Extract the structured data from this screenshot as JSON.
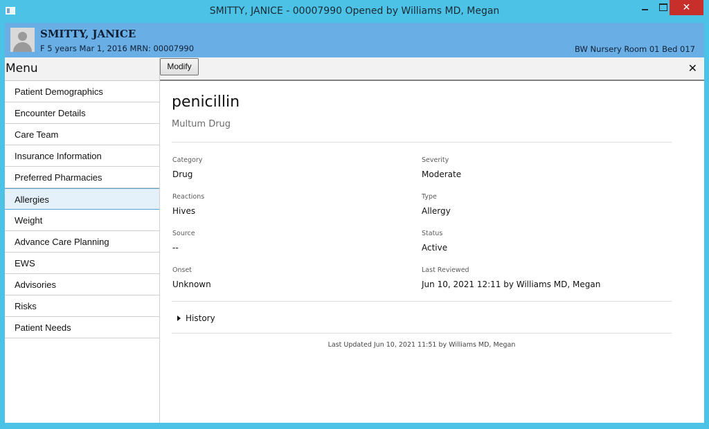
{
  "window": {
    "title": "SMITTY, JANICE - 00007990 Opened by Williams MD, Megan",
    "close_glyph": "✕"
  },
  "patient": {
    "name": "SMITTY, JANICE",
    "info": "F 5 years Mar 1, 2016 MRN: 00007990",
    "location": "BW Nursery Room 01 Bed 017"
  },
  "menu": {
    "header": "Menu",
    "items": [
      {
        "label": "Patient Demographics"
      },
      {
        "label": "Encounter Details"
      },
      {
        "label": "Care Team"
      },
      {
        "label": "Insurance Information"
      },
      {
        "label": "Preferred Pharmacies"
      },
      {
        "label": "Allergies"
      },
      {
        "label": "Weight"
      },
      {
        "label": "Advance Care Planning"
      },
      {
        "label": "EWS"
      },
      {
        "label": "Advisories"
      },
      {
        "label": "Risks"
      },
      {
        "label": "Patient Needs"
      }
    ],
    "selected": "Allergies"
  },
  "toolbar": {
    "modify_label": "Modify",
    "close_glyph": "✕"
  },
  "allergy": {
    "name": "penicillin",
    "subtitle": "Multum Drug",
    "fields": {
      "category": {
        "label": "Category",
        "value": "Drug"
      },
      "severity": {
        "label": "Severity",
        "value": "Moderate"
      },
      "reactions": {
        "label": "Reactions",
        "value": "Hives"
      },
      "type": {
        "label": "Type",
        "value": "Allergy"
      },
      "source": {
        "label": "Source",
        "value": "--"
      },
      "status": {
        "label": "Status",
        "value": "Active"
      },
      "onset": {
        "label": "Onset",
        "value": "Unknown"
      },
      "last_reviewed": {
        "label": "Last Reviewed",
        "value": "Jun 10, 2021 12:11 by Williams MD, Megan"
      }
    },
    "history_label": "History",
    "last_updated": "Last Updated Jun 10, 2021 11:51 by Williams MD, Megan"
  },
  "colors": {
    "frame": "#4cc2e6",
    "banner": "#6aaee6",
    "selected_item": "#e4f1fb",
    "close_button": "#c7302a"
  }
}
